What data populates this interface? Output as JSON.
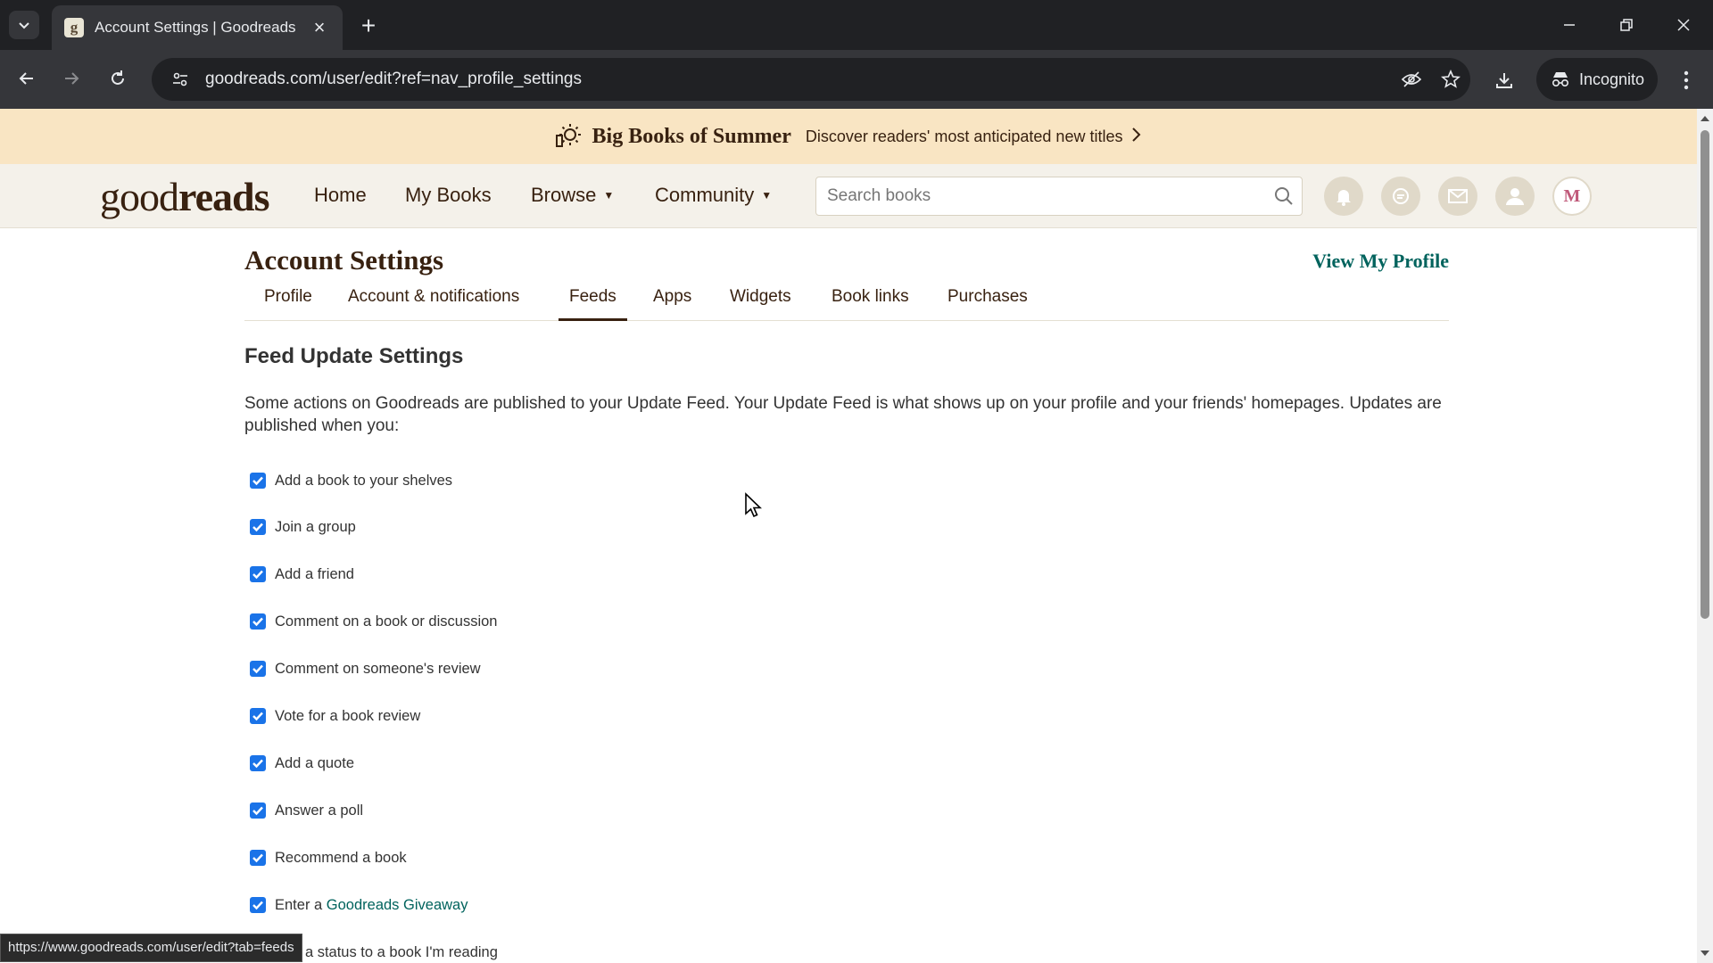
{
  "browser": {
    "tab_title": "Account Settings | Goodreads",
    "favicon_letter": "g",
    "url": "goodreads.com/user/edit?ref=nav_profile_settings",
    "incognito_label": "Incognito",
    "status_url": "https://www.goodreads.com/user/edit?tab=feeds"
  },
  "banner": {
    "title": "Big Books of Summer",
    "subtitle": "Discover readers' most anticipated new titles"
  },
  "header": {
    "logo_light": "good",
    "logo_bold": "reads",
    "nav": {
      "home": "Home",
      "my_books": "My Books",
      "browse": "Browse",
      "community": "Community"
    },
    "search_placeholder": "Search books",
    "avatar_initial": "M"
  },
  "settings": {
    "title": "Account Settings",
    "view_profile": "View My Profile",
    "tabs": [
      "Profile",
      "Account & notifications",
      "Feeds",
      "Apps",
      "Widgets",
      "Book links",
      "Purchases"
    ],
    "active_tab": "Feeds",
    "section_title": "Feed Update Settings",
    "intro": "Some actions on Goodreads are published to your Update Feed. Your Update Feed is what shows up on your profile and your friends' homepages. Updates are published when you:",
    "checks": [
      {
        "label": "Add a book to your shelves",
        "checked": true
      },
      {
        "label": "Join a group",
        "checked": true
      },
      {
        "label": "Add a friend",
        "checked": true
      },
      {
        "label": "Comment on a book or discussion",
        "checked": true
      },
      {
        "label": "Comment on someone's review",
        "checked": true
      },
      {
        "label": "Vote for a book review",
        "checked": true
      },
      {
        "label": "Add a quote",
        "checked": true
      },
      {
        "label": "Answer a poll",
        "checked": true
      },
      {
        "label": "Recommend a book",
        "checked": true
      },
      {
        "label": "Enter a ",
        "link": "Goodreads Giveaway",
        "checked": true
      },
      {
        "label": "Add a status to a book I'm reading",
        "checked": true
      }
    ]
  },
  "colors": {
    "banner_bg": "#f9e5c3",
    "header_bg": "#f4f1ea",
    "brand_brown": "#382110",
    "link_green": "#00635d",
    "checkbox_blue": "#1a73e8"
  }
}
